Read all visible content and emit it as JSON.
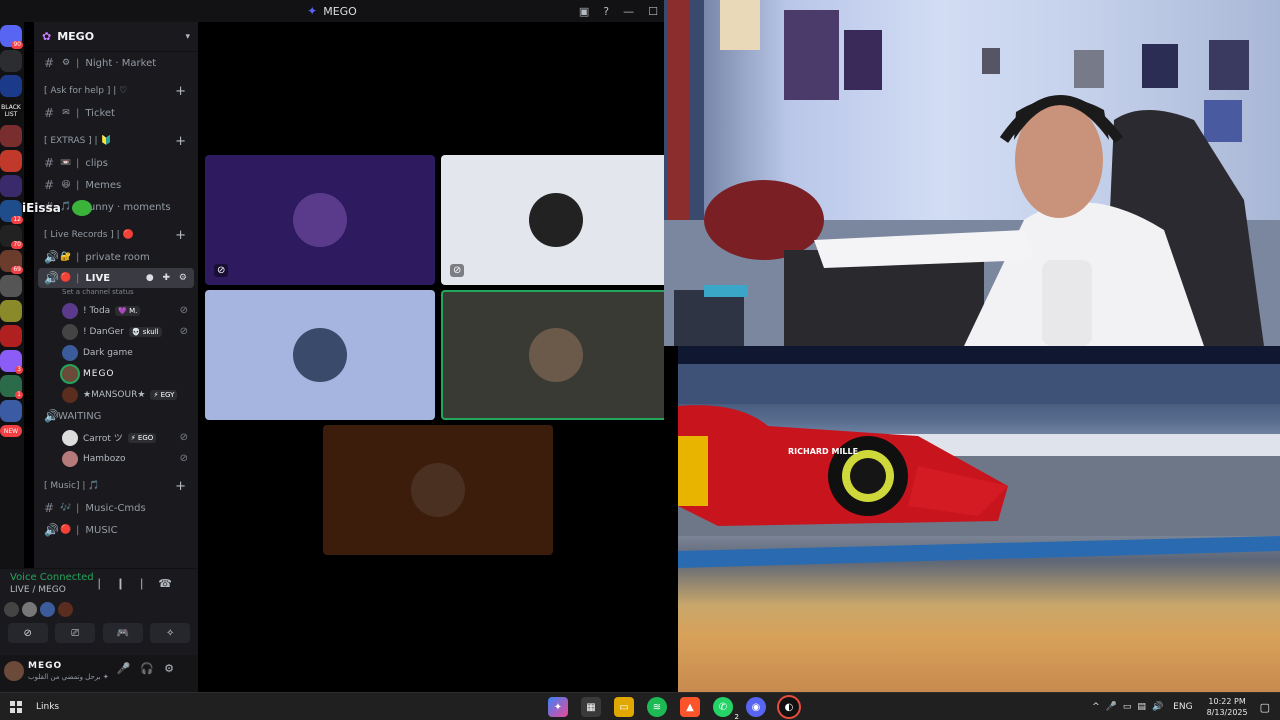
{
  "window": {
    "title": "MEGO"
  },
  "server": {
    "name": "MEGO"
  },
  "rail": [
    {
      "color": "#5865f2",
      "badge": "90"
    },
    {
      "color": "#2b2d31",
      "badge": ""
    },
    {
      "color": "#1b3a8a",
      "badge": ""
    },
    {
      "color": "#111111",
      "badge": ""
    },
    {
      "color": "#7a2d2d",
      "badge": ""
    },
    {
      "color": "#c0392b",
      "badge": ""
    },
    {
      "color": "#3b2a6b",
      "badge": ""
    },
    {
      "color": "#1f4c8a",
      "badge": "12"
    },
    {
      "color": "#222222",
      "badge": "70"
    },
    {
      "color": "#6b3b2b",
      "badge": "69"
    },
    {
      "color": "#555555",
      "badge": ""
    },
    {
      "color": "#8a8a2b",
      "badge": ""
    },
    {
      "color": "#b02020",
      "badge": ""
    },
    {
      "color": "#8b5cf6",
      "badge": "3"
    },
    {
      "color": "#2b6b4a",
      "badge": "1"
    },
    {
      "color": "#3b5ba5",
      "badge": ""
    }
  ],
  "rail_labels": {
    "blacklist": "BLACK LIST",
    "new": "NEW"
  },
  "channels": {
    "night_market": {
      "emoji": "⚙",
      "label": "Night · Market"
    },
    "cat_help": "[ Ask for help ] | ♡",
    "ticket": {
      "emoji": "✉",
      "label": "Ticket"
    },
    "cat_extras": "[ EXTRAS ] | 🔰",
    "clips": {
      "emoji": "📼",
      "label": "clips"
    },
    "memes": {
      "emoji": "😆",
      "label": "Memes"
    },
    "funny": {
      "emoji": "🎵",
      "label": "funny · moments"
    },
    "cat_live": "[ Live Records ] | 🔴",
    "private_room": {
      "emoji": "🔐",
      "label": "private room"
    },
    "live": {
      "emoji": "🔴",
      "label": "LIVE",
      "status": "Set a channel status"
    },
    "cat_music": "[ Music] | 🎵",
    "music_cmds": {
      "emoji": "🎶",
      "label": "Music-Cmds"
    },
    "music": {
      "emoji": "🔴",
      "label": "MUSIC"
    },
    "waiting": {
      "label": "WAITING"
    }
  },
  "live_users": [
    {
      "name": "! Toda",
      "tag": "💜 M.",
      "color": "#5b3a8c",
      "muted": true
    },
    {
      "name": "! DanGer",
      "tag": "💀 skull",
      "color": "#444444",
      "muted": true
    },
    {
      "name": "Dark game",
      "tag": "",
      "color": "#3b5b9a",
      "muted": false
    },
    {
      "name": "MEGO",
      "tag": "",
      "color": "#6b4a3a",
      "muted": false
    },
    {
      "name": "★MANSOUR★",
      "tag": "⚡ EGY",
      "color": "#5a2d1f",
      "muted": false
    }
  ],
  "waiting_users": [
    {
      "name": "Carrot ツ",
      "tag": "⚡ EGO",
      "color": "#dddddd",
      "muted": true
    },
    {
      "name": "Hambozo",
      "tag": "",
      "color": "#b57a7a",
      "muted": true
    }
  ],
  "overlay": {
    "name": "iEissa"
  },
  "voice": {
    "title": "Voice Connected",
    "channel": "LIVE / MEGO"
  },
  "user": {
    "name": "MEGO",
    "status": "برحل وتمضي من القلوب ✦"
  },
  "stage_tiles": [
    {
      "bg": "#2e1a5e",
      "avatar": "#5a3a8a",
      "muted": true,
      "speaking": false
    },
    {
      "bg": "#e4e6ee",
      "avatar": "#222222",
      "muted": true,
      "speaking": false
    },
    {
      "bg": "#a6b4e0",
      "avatar": "#3a4a6a",
      "muted": false,
      "speaking": false
    },
    {
      "bg": "#3a3a34",
      "avatar": "#6b5a4a",
      "muted": false,
      "speaking": true
    },
    {
      "bg": "#3c1d0c",
      "avatar": "#4a3020",
      "muted": false,
      "speaking": false
    }
  ],
  "game_text": {
    "sponsor": "RICHARD MILLE"
  },
  "taskbar": {
    "links": "Links",
    "lang": "ENG",
    "time": "10:22 PM",
    "date": "8/13/2025",
    "whatsapp_badge": "2"
  }
}
